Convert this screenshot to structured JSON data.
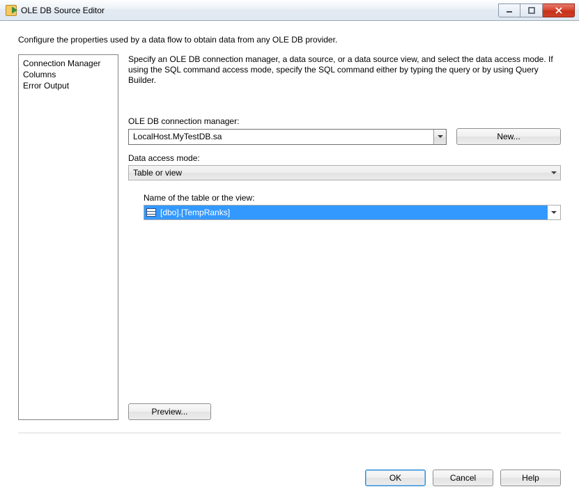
{
  "window": {
    "title": "OLE DB Source Editor"
  },
  "top_description": "Configure the properties used by a data flow to obtain data from any OLE DB provider.",
  "nav": {
    "items": [
      "Connection Manager",
      "Columns",
      "Error Output"
    ]
  },
  "main": {
    "instructions": "Specify an OLE DB connection manager, a data source, or a data source view, and select the data access mode. If using the SQL command access mode, specify the SQL command either by typing the query or by using Query Builder.",
    "conn_label": "OLE DB connection manager:",
    "conn_value": "LocalHost.MyTestDB.sa",
    "new_button": "New...",
    "mode_label": "Data access mode:",
    "mode_value": "Table or view",
    "table_label": "Name of the table or the view:",
    "table_value": "[dbo].[TempRanks]",
    "preview_button": "Preview..."
  },
  "footer": {
    "ok": "OK",
    "cancel": "Cancel",
    "help": "Help"
  }
}
